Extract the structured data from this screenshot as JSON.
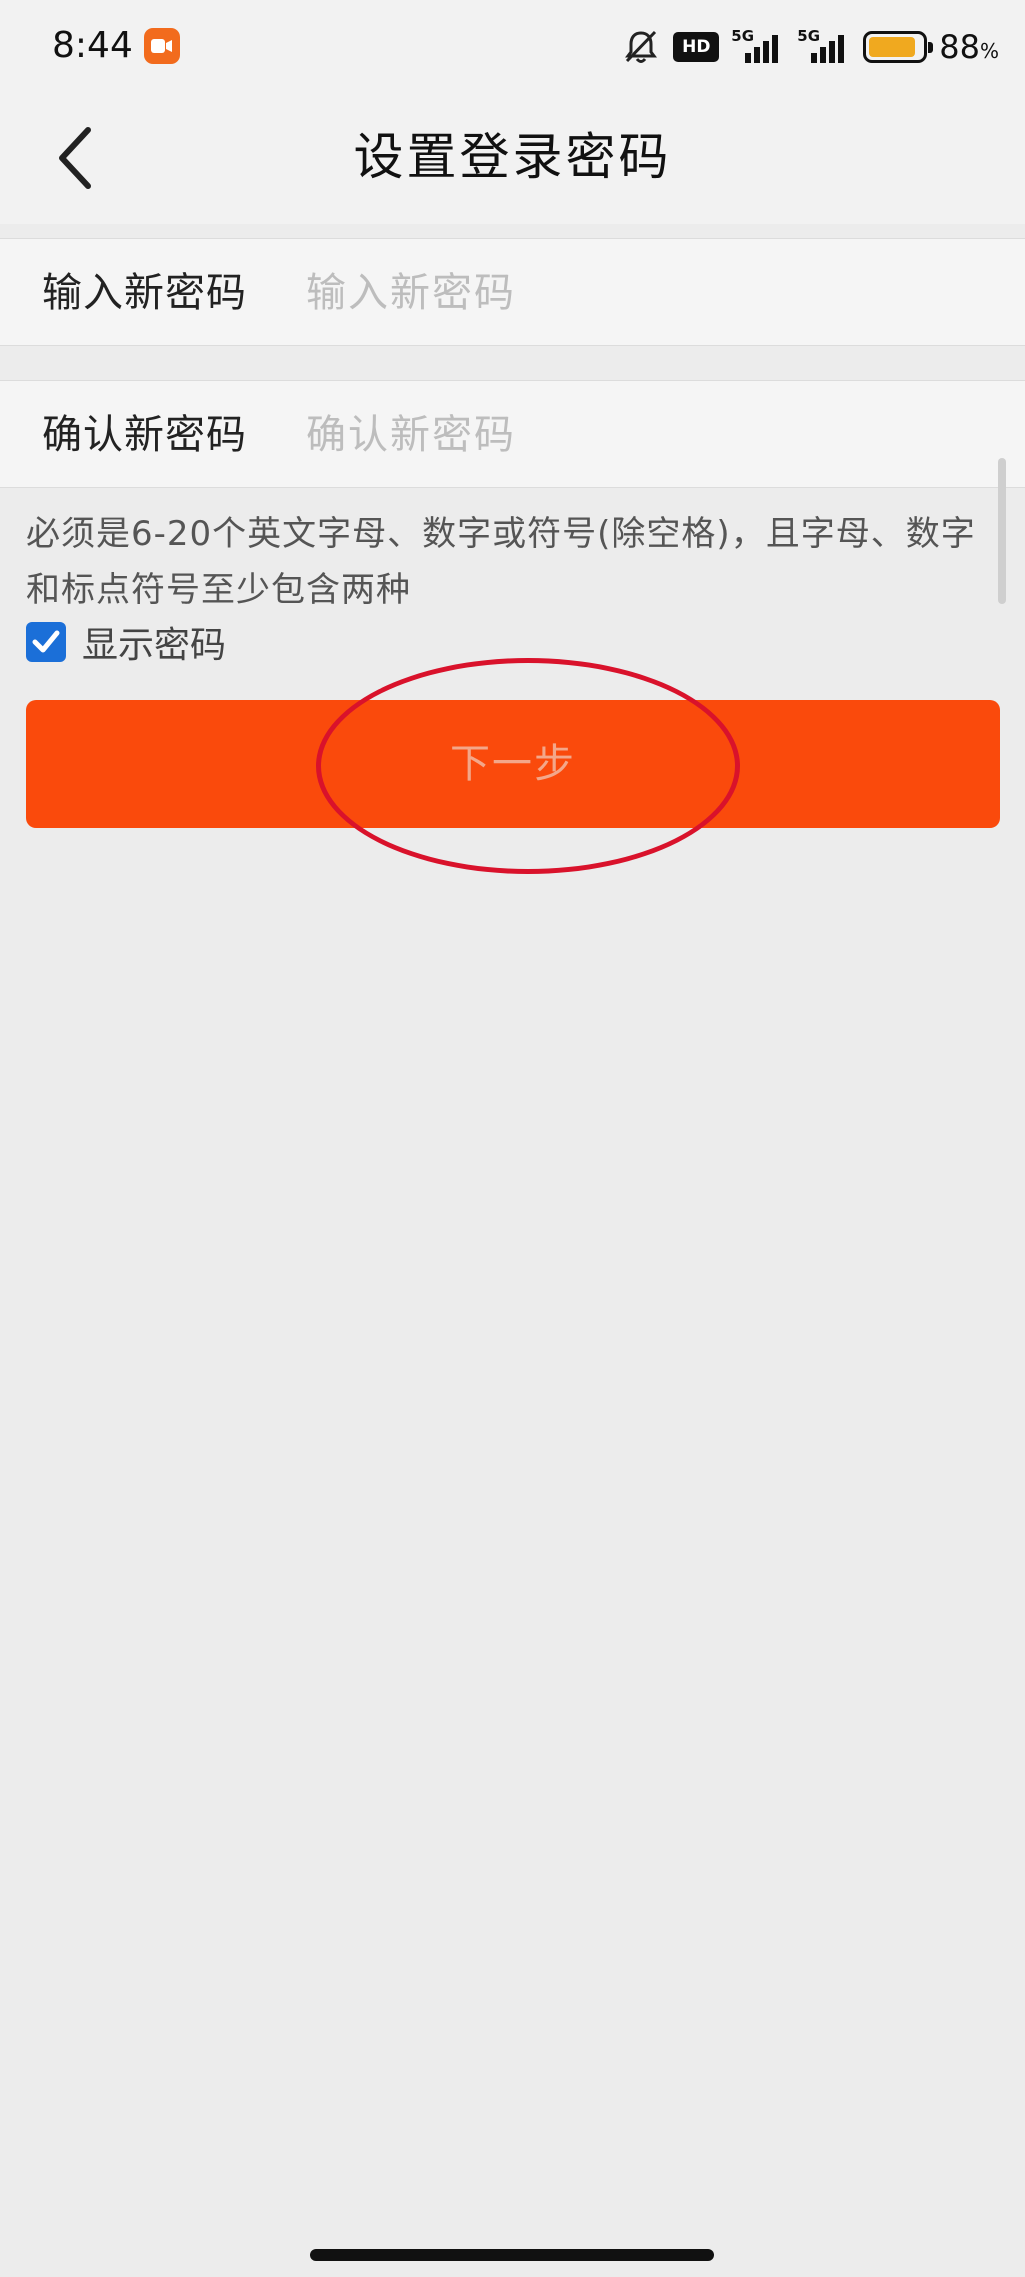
{
  "status_bar": {
    "time": "8:44",
    "hd_label": "HD",
    "network_1": "5G",
    "network_2": "5G",
    "battery_percent": "88",
    "battery_unit": "%",
    "battery_level": 0.88,
    "icons": [
      "screen-record-icon",
      "bell-muted-icon",
      "hd-icon",
      "signal-icon",
      "signal-icon",
      "battery-icon"
    ]
  },
  "header": {
    "title": "设置登录密码",
    "back_icon": "chevron-left-icon"
  },
  "form": {
    "new_password": {
      "label": "输入新密码",
      "placeholder": "输入新密码",
      "value": ""
    },
    "confirm_password": {
      "label": "确认新密码",
      "placeholder": "确认新密码",
      "value": ""
    },
    "hint": "必须是6-20个英文字母、数字或符号(除空格)，且字母、数字和标点符号至少包含两种",
    "show_password": {
      "label": "显示密码",
      "checked": true
    },
    "next_button": {
      "label": "下一步"
    }
  },
  "colors": {
    "accent": "#fa4a0c",
    "checkbox": "#1b6fd8",
    "annotation": "#d9122b",
    "background": "#ececec"
  }
}
